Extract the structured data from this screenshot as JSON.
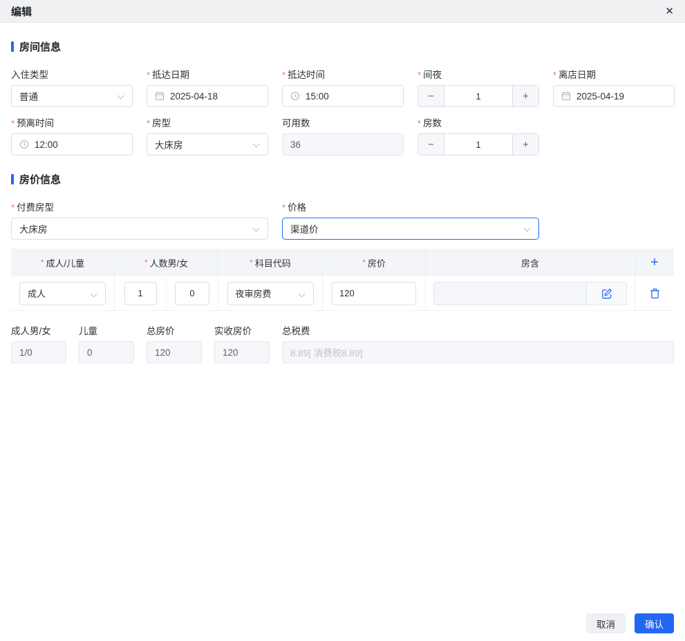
{
  "header": {
    "title": "编辑"
  },
  "icons": {
    "close": "✕",
    "minus": "−",
    "plus": "+",
    "add": "+"
  },
  "sections": {
    "room": "房间信息",
    "price": "房价信息"
  },
  "fields": {
    "checkin_type": {
      "label": "入住类型",
      "required": false,
      "value": "普通"
    },
    "arrival_date": {
      "label": "抵达日期",
      "required": true,
      "value": "2025-04-18"
    },
    "arrival_time": {
      "label": "抵达时间",
      "required": true,
      "value": "15:00"
    },
    "nights": {
      "label": "间夜",
      "required": true,
      "value": "1"
    },
    "departure_date": {
      "label": "离店日期",
      "required": true,
      "value": "2025-04-19"
    },
    "expected_departure": {
      "label": "预离时间",
      "required": true,
      "value": "12:00"
    },
    "room_type": {
      "label": "房型",
      "required": true,
      "value": "大床房"
    },
    "available_count": {
      "label": "可用数",
      "required": false,
      "value": "36"
    },
    "room_count": {
      "label": "房数",
      "required": true,
      "value": "1"
    },
    "paid_room_type": {
      "label": "付费房型",
      "required": true,
      "value": "大床房"
    },
    "price_plan": {
      "label": "价格",
      "required": true,
      "value": "渠道价"
    }
  },
  "price_table": {
    "headers": {
      "adult_child": "成人/儿童",
      "count_mf": "人数男/女",
      "subject_code": "科目代码",
      "room_price": "房价",
      "room_includes": "房含"
    },
    "row": {
      "adult_child": "成人",
      "count_m": "1",
      "count_f": "0",
      "subject_code": "夜审房费",
      "room_price": "120",
      "room_includes": ""
    }
  },
  "summary": {
    "adult_mf": {
      "label": "成人男/女",
      "value": "1/0"
    },
    "children": {
      "label": "儿童",
      "value": "0"
    },
    "total_price": {
      "label": "总房价",
      "value": "120"
    },
    "actual_price": {
      "label": "实收房价",
      "value": "120"
    },
    "total_tax": {
      "label": "总税费",
      "value": "8.89[ 消费税8.89]"
    }
  },
  "footer": {
    "cancel": "取消",
    "confirm": "确认"
  },
  "colors": {
    "accent": "#2368f2",
    "required_mark": "#f56c6c",
    "header_bg": "#f0f1f3",
    "table_header_bg": "#f3f5f8",
    "disabled_bg": "#f5f7fa",
    "border": "#dcdfe6",
    "placeholder": "#c0c4cc"
  }
}
